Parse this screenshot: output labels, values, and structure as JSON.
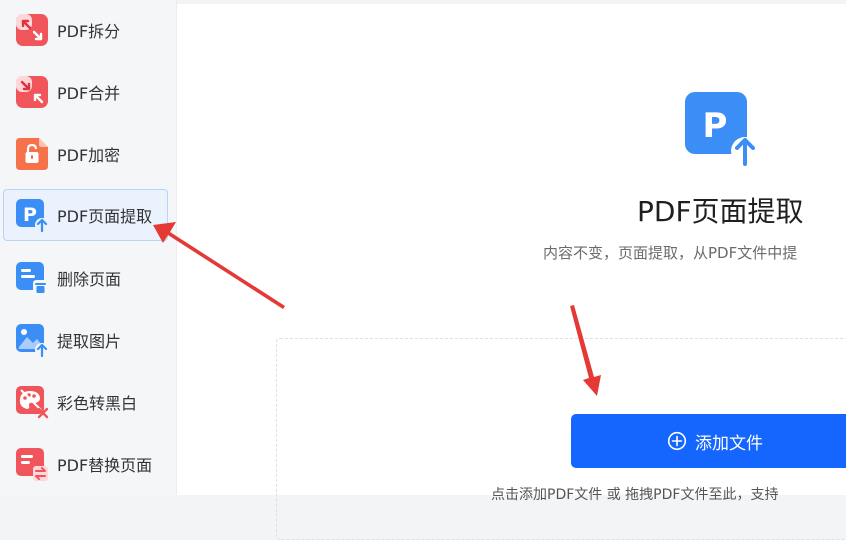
{
  "sidebar": {
    "items": [
      {
        "label": "PDF拆分",
        "icon": "split-icon",
        "color": "#f0555c"
      },
      {
        "label": "PDF合并",
        "icon": "merge-icon",
        "color": "#f0555c"
      },
      {
        "label": "PDF加密",
        "icon": "lock-icon",
        "color": "#f5724a"
      },
      {
        "label": "PDF页面提取",
        "icon": "page-extract-icon",
        "color": "#3a8ef6",
        "active": true
      },
      {
        "label": "删除页面",
        "icon": "delete-page-icon",
        "color": "#3a8ef6"
      },
      {
        "label": "提取图片",
        "icon": "extract-image-icon",
        "color": "#3a8ef6"
      },
      {
        "label": "彩色转黑白",
        "icon": "color-to-bw-icon",
        "color": "#f0555c"
      },
      {
        "label": "PDF替换页面",
        "icon": "replace-page-icon",
        "color": "#f0555c"
      }
    ]
  },
  "main": {
    "title": "PDF页面提取",
    "subtitle": "内容不变，页面提取，从PDF文件中提",
    "add_button_label": "添加文件",
    "hint": "点击添加PDF文件 或 拖拽PDF文件至此，支持"
  },
  "colors": {
    "accent": "#1466ff",
    "active_bg": "#eaf2fd",
    "annotation_arrow": "#e53935"
  }
}
